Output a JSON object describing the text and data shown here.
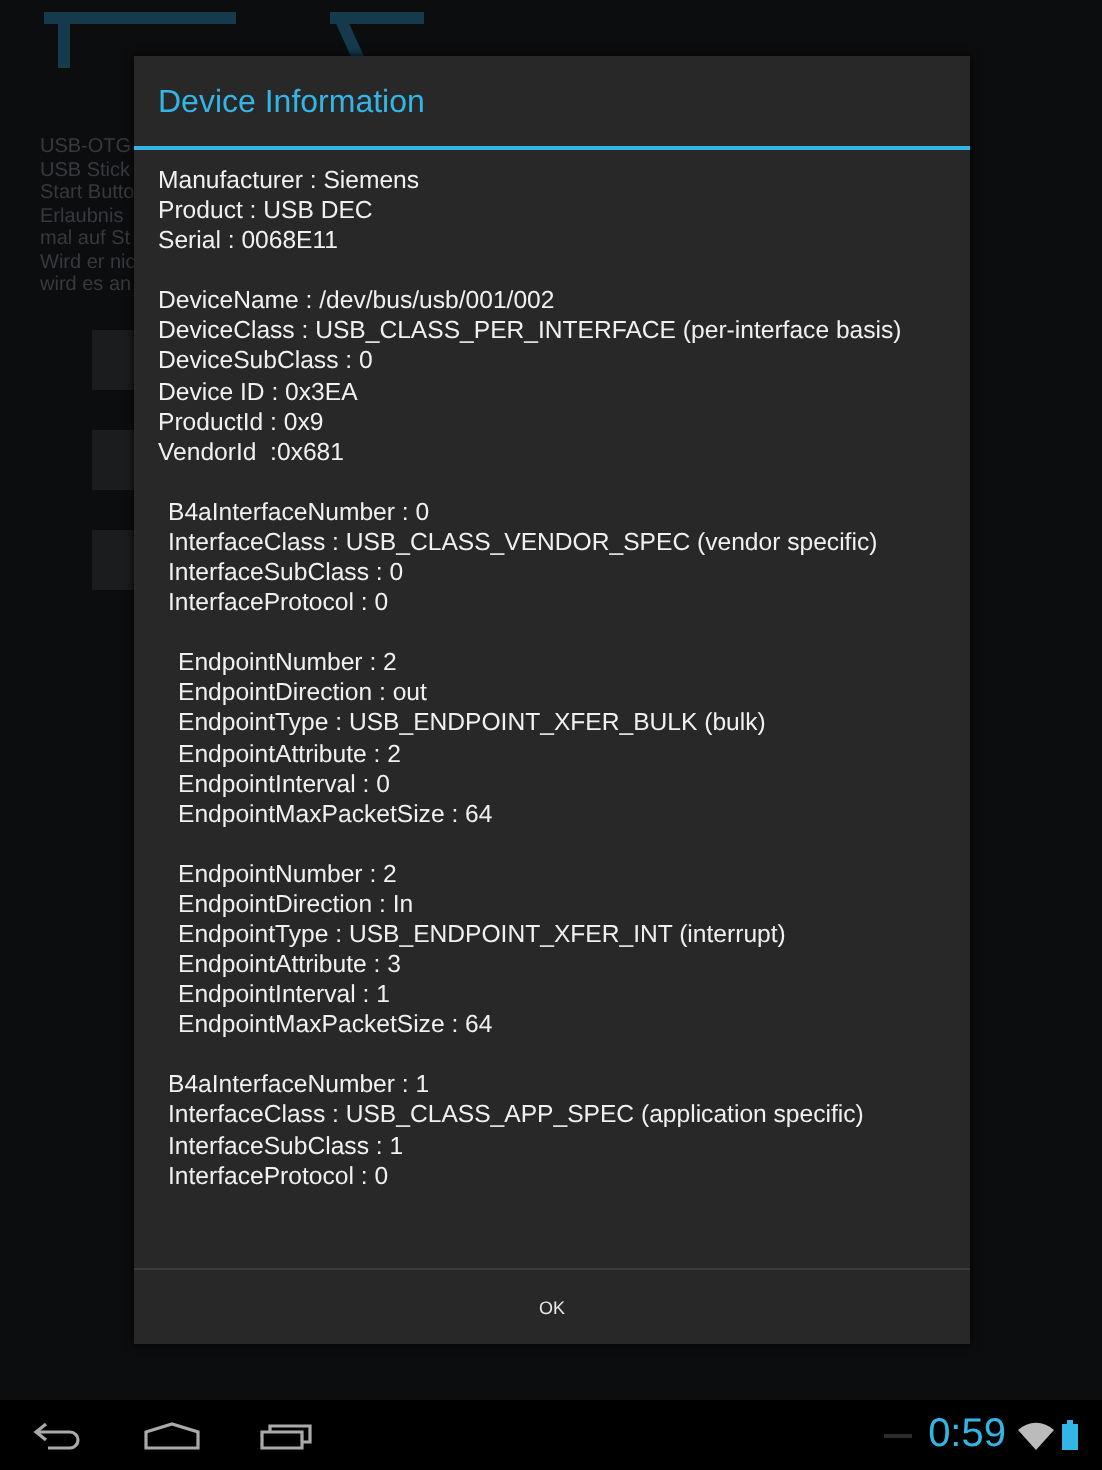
{
  "background_app": {
    "text_lines": [
      "USB-OTG",
      "USB Stick",
      "Start Butto",
      "Erlaubnis",
      "mal auf St",
      "Wird er nic",
      "wird es an"
    ]
  },
  "dialog": {
    "title": "Device Information",
    "device": [
      "Manufacturer : Siemens",
      "Product : USB DEC",
      "Serial : 0068E11"
    ],
    "device_details": [
      "DeviceName : /dev/bus/usb/001/002",
      "DeviceClass : USB_CLASS_PER_INTERFACE (per-interface basis)",
      "DeviceSubClass : 0",
      "Device ID : 0x3EA",
      "ProductId : 0x9",
      "VendorId  :0x681"
    ],
    "interfaces": [
      {
        "lines": [
          "B4aInterfaceNumber : 0",
          "InterfaceClass : USB_CLASS_VENDOR_SPEC (vendor specific)",
          "InterfaceSubClass : 0",
          "InterfaceProtocol : 0"
        ],
        "endpoints": [
          {
            "lines": [
              "EndpointNumber : 2",
              "EndpointDirection : out",
              "EndpointType : USB_ENDPOINT_XFER_BULK (bulk)",
              "EndpointAttribute : 2",
              "EndpointInterval : 0",
              "EndpointMaxPacketSize : 64"
            ]
          },
          {
            "lines": [
              "EndpointNumber : 2",
              "EndpointDirection : In",
              "EndpointType : USB_ENDPOINT_XFER_INT (interrupt)",
              "EndpointAttribute : 3",
              "EndpointInterval : 1",
              "EndpointMaxPacketSize : 64"
            ]
          }
        ]
      },
      {
        "lines": [
          "B4aInterfaceNumber : 1",
          "InterfaceClass : USB_CLASS_APP_SPEC (application specific)",
          "InterfaceSubClass : 1",
          "InterfaceProtocol : 0"
        ]
      }
    ],
    "button": "OK"
  },
  "nav_bar": {
    "time": "0:59"
  }
}
